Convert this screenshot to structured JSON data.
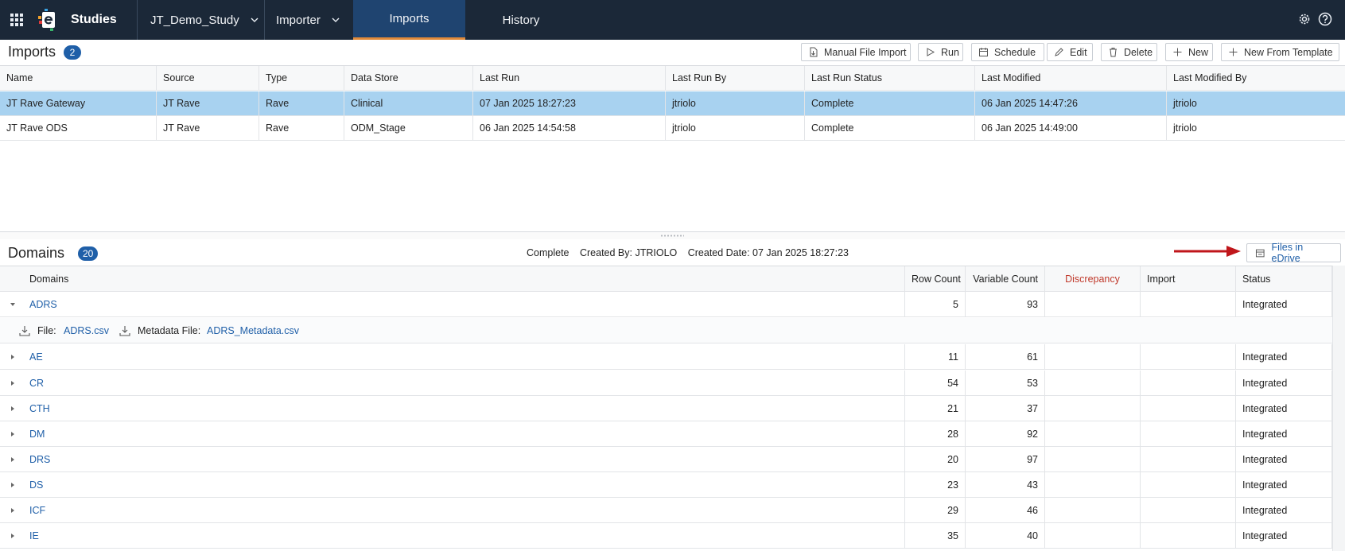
{
  "nav": {
    "brand": "Studies",
    "study": "JT_Demo_Study",
    "module": "Importer",
    "tabs": [
      {
        "label": "Imports",
        "active": true
      },
      {
        "label": "History",
        "active": false
      }
    ],
    "icons": [
      "apps-grid-icon",
      "app-logo",
      "gear-icon",
      "help-icon"
    ]
  },
  "imports": {
    "title": "Imports",
    "count": "2",
    "toolbar": {
      "manual_file_import": "Manual File Import",
      "run": "Run",
      "schedule": "Schedule",
      "edit": "Edit",
      "delete": "Delete",
      "new": "New",
      "new_from_template": "New From Template"
    },
    "columns": [
      "Name",
      "Source",
      "Type",
      "Data Store",
      "Last Run",
      "Last Run By",
      "Last Run Status",
      "Last Modified",
      "Last Modified By"
    ],
    "rows": [
      {
        "cells": [
          "JT Rave Gateway",
          "JT Rave",
          "Rave",
          "Clinical",
          "07 Jan 2025 18:27:23",
          "jtriolo",
          "Complete",
          "06 Jan 2025 14:47:26",
          "jtriolo"
        ],
        "selected": true
      },
      {
        "cells": [
          "JT Rave ODS",
          "JT Rave",
          "Rave",
          "ODM_Stage",
          "06 Jan 2025 14:54:58",
          "jtriolo",
          "Complete",
          "06 Jan 2025 14:49:00",
          "jtriolo"
        ],
        "selected": false
      }
    ]
  },
  "domains": {
    "title": "Domains",
    "count": "20",
    "status": "Complete",
    "created_by": "Created By: JTRIOLO",
    "created_date": "Created Date: 07 Jan 2025 18:27:23",
    "files_button": "Files in eDrive",
    "columns": [
      "Domains",
      "Row Count",
      "Variable Count",
      "Discrepancy",
      "Import",
      "Status"
    ],
    "detail": {
      "file_label": "File:",
      "file_name": "ADRS.csv",
      "metadata_label": "Metadata File:",
      "metadata_name": "ADRS_Metadata.csv"
    },
    "rows": [
      {
        "name": "ADRS",
        "row_count": "5",
        "variable_count": "93",
        "status": "Integrated",
        "expanded": true
      },
      {
        "name": "AE",
        "row_count": "11",
        "variable_count": "61",
        "status": "Integrated",
        "expanded": false
      },
      {
        "name": "CR",
        "row_count": "54",
        "variable_count": "53",
        "status": "Integrated",
        "expanded": false
      },
      {
        "name": "CTH",
        "row_count": "21",
        "variable_count": "37",
        "status": "Integrated",
        "expanded": false
      },
      {
        "name": "DM",
        "row_count": "28",
        "variable_count": "92",
        "status": "Integrated",
        "expanded": false
      },
      {
        "name": "DRS",
        "row_count": "20",
        "variable_count": "97",
        "status": "Integrated",
        "expanded": false
      },
      {
        "name": "DS",
        "row_count": "23",
        "variable_count": "43",
        "status": "Integrated",
        "expanded": false
      },
      {
        "name": "ICF",
        "row_count": "29",
        "variable_count": "46",
        "status": "Integrated",
        "expanded": false
      },
      {
        "name": "IE",
        "row_count": "35",
        "variable_count": "40",
        "status": "Integrated",
        "expanded": false
      }
    ]
  },
  "colors": {
    "nav_bg": "#1b2838",
    "active_tab_bg": "#1f4470",
    "active_tab_underline": "#e08a3a",
    "accent": "#1f5fa8",
    "selected_row": "#a8d2f0",
    "discrepancy_header": "#c0392b",
    "annotation_arrow": "#c0161b"
  }
}
